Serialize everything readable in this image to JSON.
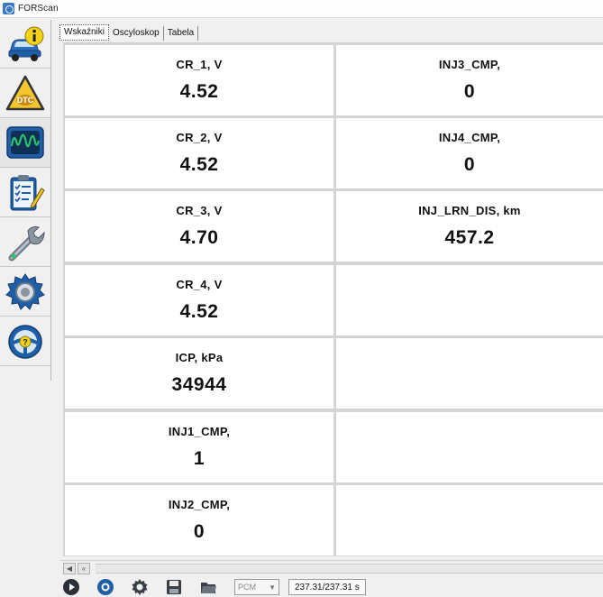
{
  "window": {
    "title": "FORScan"
  },
  "sidebar": {
    "items": [
      {
        "name": "vehicle-info",
        "icon": "car-info-icon"
      },
      {
        "name": "dtc",
        "icon": "dtc-warning-icon",
        "label": "DTC"
      },
      {
        "name": "oscilloscope",
        "icon": "oscilloscope-icon",
        "active": true
      },
      {
        "name": "tests",
        "icon": "clipboard-checklist-icon"
      },
      {
        "name": "service",
        "icon": "wrench-icon"
      },
      {
        "name": "configuration",
        "icon": "gear-icon"
      },
      {
        "name": "help",
        "icon": "steering-wheel-help-icon",
        "label": "?"
      }
    ]
  },
  "tabs": [
    {
      "label": "Wskaźniki",
      "active": true
    },
    {
      "label": "Oscyloskop"
    },
    {
      "label": "Tabela"
    }
  ],
  "gauges": {
    "left": [
      {
        "name": "CR_1, V",
        "value": "4.52"
      },
      {
        "name": "CR_2, V",
        "value": "4.52"
      },
      {
        "name": "CR_3, V",
        "value": "4.70"
      },
      {
        "name": "CR_4, V",
        "value": "4.52"
      },
      {
        "name": "ICP, kPa",
        "value": "34944"
      },
      {
        "name": "INJ1_CMP,",
        "value": "1"
      },
      {
        "name": "INJ2_CMP,",
        "value": "0"
      }
    ],
    "right": [
      {
        "name": "INJ3_CMP,",
        "value": "0"
      },
      {
        "name": "INJ4_CMP,",
        "value": "0"
      },
      {
        "name": "INJ_LRN_DIS, km",
        "value": "457.2"
      },
      {
        "name": "",
        "value": ""
      },
      {
        "name": "",
        "value": ""
      },
      {
        "name": "",
        "value": ""
      },
      {
        "name": "",
        "value": ""
      }
    ]
  },
  "toolbar": {
    "buttons": [
      "play-icon",
      "record-icon",
      "settings-icon",
      "save-icon",
      "open-folder-icon"
    ],
    "module_select": "PCM",
    "time": "237.31/237.31 s"
  },
  "colors": {
    "dtc_yellow": "#f2c62c",
    "info_yellow": "#f5d21a",
    "sidebar_blue": "#1f5fa8",
    "scope_green": "#2ec46b"
  }
}
